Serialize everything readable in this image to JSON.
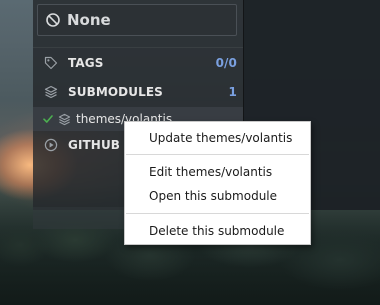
{
  "branch_filter": {
    "label": "None",
    "icon": "none-circle-icon"
  },
  "sidebar": {
    "tags": {
      "label": "TAGS",
      "count": "0/0",
      "icon": "tag-icon"
    },
    "submodules": {
      "label": "SUBMODULES",
      "count": "1",
      "icon": "layers-icon"
    },
    "submodule_item": {
      "label": "themes/volantis",
      "status_icon": "check-icon",
      "icon": "layers-icon"
    },
    "github": {
      "label": "GITHUB A",
      "icon": "play-circle-icon"
    }
  },
  "context_menu": {
    "items": [
      {
        "label": "Update themes/volantis"
      },
      {
        "label": "Edit themes/volantis"
      },
      {
        "label": "Open this submodule"
      },
      {
        "label": "Delete this submodule"
      }
    ]
  },
  "colors": {
    "accent_count": "#7aa0e0",
    "check_green": "#4caf50",
    "menu_background": "#ffffff"
  }
}
